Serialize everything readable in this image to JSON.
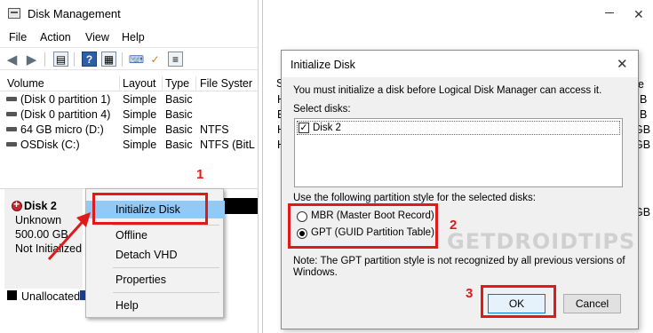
{
  "left_window": {
    "title": "Disk Management",
    "menu": [
      "File",
      "Action",
      "View",
      "Help"
    ],
    "toolbar_icons": [
      "back-icon",
      "forward-icon",
      "properties-icon",
      "help-icon",
      "grid-icon",
      "connect-icon",
      "check-icon",
      "list-icon"
    ],
    "columns": [
      "Volume",
      "Layout",
      "Type",
      "File Syster"
    ],
    "volumes": [
      {
        "volume": "(Disk 0 partition 1)",
        "layout": "Simple",
        "type": "Basic",
        "fs": ""
      },
      {
        "volume": "(Disk 0 partition 4)",
        "layout": "Simple",
        "type": "Basic",
        "fs": ""
      },
      {
        "volume": "64 GB micro (D:)",
        "layout": "Simple",
        "type": "Basic",
        "fs": "NTFS"
      },
      {
        "volume": "OSDisk (C:)",
        "layout": "Simple",
        "type": "Basic",
        "fs": "NTFS (BitL"
      }
    ],
    "disk": {
      "name": "Disk 2",
      "kind": "Unknown",
      "size": "500.00 GB",
      "state": "Not Initialized"
    },
    "legend": "Unallocated",
    "context_menu": [
      "Initialize Disk",
      "Offline",
      "Detach VHD",
      "Properties",
      "Help"
    ]
  },
  "right_window": {
    "partial_header": "S",
    "fragments": [
      "H",
      "B",
      "H",
      "H",
      "GB",
      "GB",
      "GB"
    ]
  },
  "dialog": {
    "title": "Initialize Disk",
    "message": "You must initialize a disk before Logical Disk Manager can access it.",
    "select_label": "Select disks:",
    "disks": [
      {
        "label": "Disk 2",
        "checked": true
      }
    ],
    "style_label": "Use the following partition style for the selected disks:",
    "options": [
      {
        "label": "MBR (Master Boot Record)",
        "selected": false
      },
      {
        "label": "GPT (GUID Partition Table)",
        "selected": true
      }
    ],
    "note_line1": "Note: The GPT partition style is not recognized by all previous versions of",
    "note_line2": "Windows.",
    "ok": "OK",
    "cancel": "Cancel"
  },
  "annotations": {
    "step1": "1",
    "step2": "2",
    "step3": "3"
  },
  "watermark": "GETDROIDTIPS",
  "colors": {
    "annotation": "#e01a1a",
    "menu_highlight": "#91c9f7",
    "ok_border": "#0078d7"
  }
}
